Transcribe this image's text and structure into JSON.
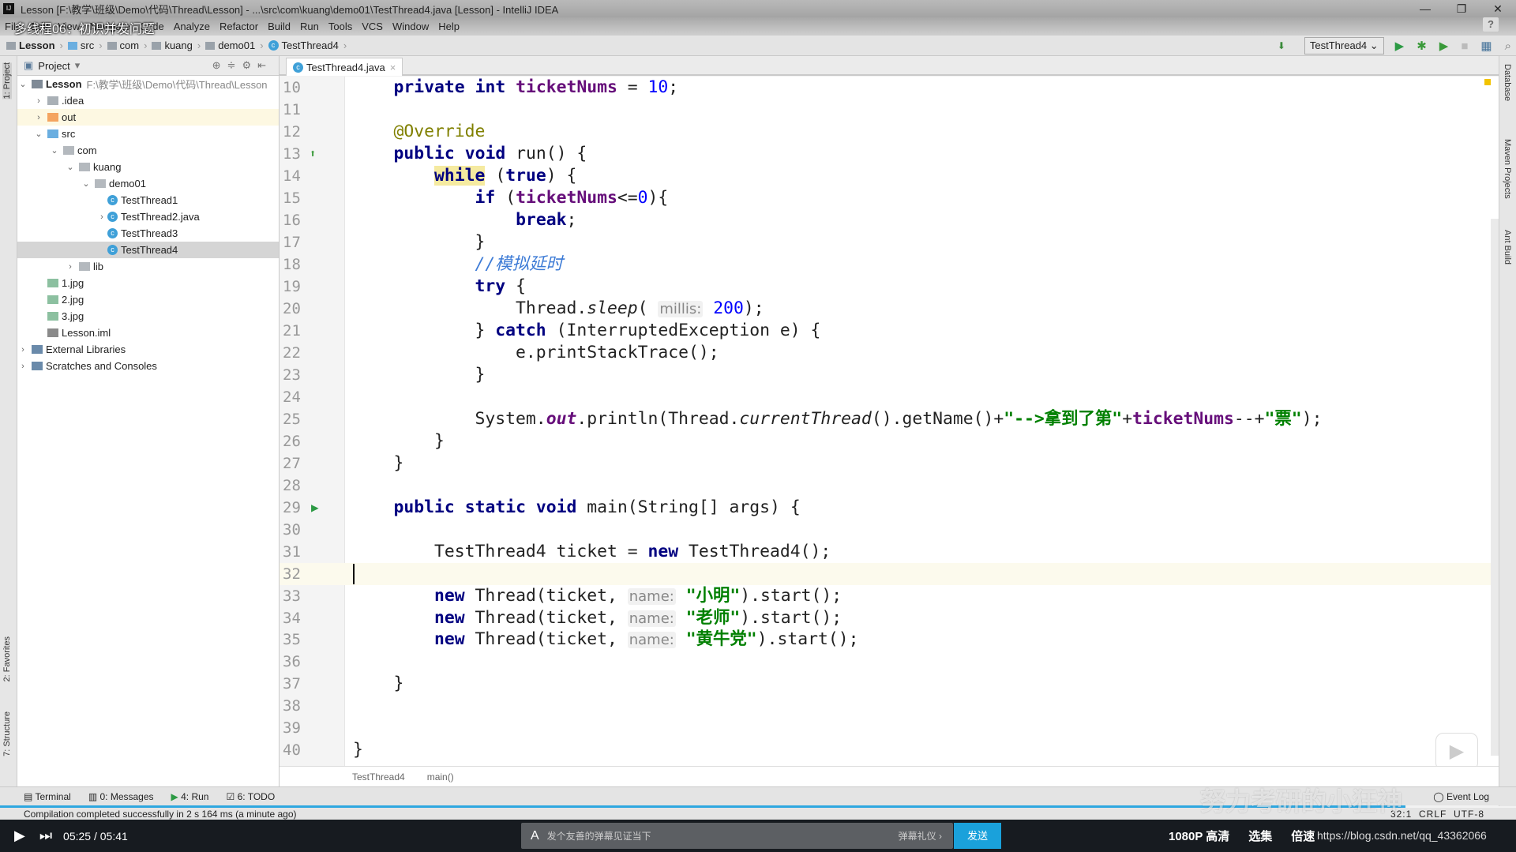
{
  "window": {
    "title": "Lesson [F:\\教学\\班级\\Demo\\代码\\Thread\\Lesson] - ...\\src\\com\\kuang\\demo01\\TestThread4.java [Lesson] - IntelliJ IDEA",
    "controls": [
      "—",
      "❐",
      "✕"
    ]
  },
  "video_overlay_title": "多线程06：初识并发问题",
  "menu": [
    "File",
    "Edit",
    "View",
    "Navigate",
    "Code",
    "Analyze",
    "Refactor",
    "Build",
    "Run",
    "Tools",
    "VCS",
    "Window",
    "Help"
  ],
  "breadcrumbs": [
    "Lesson",
    "src",
    "com",
    "kuang",
    "demo01",
    "TestThread4"
  ],
  "run_config": "TestThread4",
  "left_stripe": {
    "project": "1: Project",
    "favorites": "2: Favorites",
    "structure": "7: Structure"
  },
  "right_stripe": [
    "Database",
    "Maven Projects",
    "Ant Build"
  ],
  "project_panel": {
    "title": "Project",
    "tree": [
      {
        "label": "Lesson",
        "path": "F:\\教学\\班级\\Demo\\代码\\Thread\\Lesson",
        "depth": 0,
        "arrow": "open",
        "icon": "module",
        "bold": true
      },
      {
        "label": ".idea",
        "depth": 1,
        "arrow": "closed",
        "icon": "folder-gray"
      },
      {
        "label": "out",
        "depth": 1,
        "arrow": "closed",
        "icon": "folder-orange",
        "highlight": true
      },
      {
        "label": "src",
        "depth": 1,
        "arrow": "open",
        "icon": "folder-blue"
      },
      {
        "label": "com",
        "depth": 2,
        "arrow": "open",
        "icon": "package"
      },
      {
        "label": "kuang",
        "depth": 3,
        "arrow": "open",
        "icon": "package"
      },
      {
        "label": "demo01",
        "depth": 4,
        "arrow": "open",
        "icon": "package"
      },
      {
        "label": "TestThread1",
        "depth": 5,
        "arrow": "none",
        "icon": "class"
      },
      {
        "label": "TestThread2.java",
        "depth": 5,
        "arrow": "closed",
        "icon": "class"
      },
      {
        "label": "TestThread3",
        "depth": 5,
        "arrow": "none",
        "icon": "class"
      },
      {
        "label": "TestThread4",
        "depth": 5,
        "arrow": "none",
        "icon": "class",
        "selected": true
      },
      {
        "label": "lib",
        "depth": 3,
        "arrow": "closed",
        "icon": "package"
      },
      {
        "label": "1.jpg",
        "depth": 1,
        "arrow": "none",
        "icon": "image"
      },
      {
        "label": "2.jpg",
        "depth": 1,
        "arrow": "none",
        "icon": "image"
      },
      {
        "label": "3.jpg",
        "depth": 1,
        "arrow": "none",
        "icon": "image"
      },
      {
        "label": "Lesson.iml",
        "depth": 1,
        "arrow": "none",
        "icon": "iml"
      },
      {
        "label": "External Libraries",
        "depth": 0,
        "arrow": "closed",
        "icon": "libraries"
      },
      {
        "label": "Scratches and Consoles",
        "depth": 0,
        "arrow": "closed",
        "icon": "scratches"
      }
    ]
  },
  "editor": {
    "tab": "TestThread4.java",
    "current_line": 32,
    "lines": [
      {
        "n": "10",
        "t": [
          [
            "",
            "    "
          ],
          [
            "kw",
            "private"
          ],
          [
            "",
            " "
          ],
          [
            "kw",
            "int"
          ],
          [
            "",
            " "
          ],
          [
            "fld",
            "ticketNums"
          ],
          [
            "",
            " = "
          ],
          [
            "num",
            "10"
          ],
          [
            "",
            ";"
          ]
        ]
      },
      {
        "n": "11",
        "t": []
      },
      {
        "n": "12",
        "t": [
          [
            "",
            "    "
          ],
          [
            "ann",
            "@Override"
          ]
        ]
      },
      {
        "n": "13",
        "t": [
          [
            "",
            "    "
          ],
          [
            "kw",
            "public"
          ],
          [
            "",
            " "
          ],
          [
            "kw",
            "void"
          ],
          [
            "",
            " run() {"
          ]
        ]
      },
      {
        "n": "14",
        "t": [
          [
            "",
            "        "
          ],
          [
            "kw hlw",
            "while"
          ],
          [
            "",
            " ("
          ],
          [
            "kw",
            "true"
          ],
          [
            "",
            ") {"
          ]
        ]
      },
      {
        "n": "15",
        "t": [
          [
            "",
            "            "
          ],
          [
            "kw",
            "if"
          ],
          [
            "",
            " ("
          ],
          [
            "fld",
            "ticketNums"
          ],
          [
            "",
            "<="
          ],
          [
            "num",
            "0"
          ],
          [
            "",
            "){"
          ]
        ]
      },
      {
        "n": "16",
        "t": [
          [
            "",
            "                "
          ],
          [
            "kw",
            "break"
          ],
          [
            "",
            ";"
          ]
        ]
      },
      {
        "n": "17",
        "t": [
          [
            "",
            "            }"
          ]
        ]
      },
      {
        "n": "18",
        "t": [
          [
            "",
            "            "
          ],
          [
            "cmt",
            "//模拟延时"
          ]
        ]
      },
      {
        "n": "19",
        "t": [
          [
            "",
            "            "
          ],
          [
            "kw",
            "try"
          ],
          [
            "",
            " {"
          ]
        ]
      },
      {
        "n": "20",
        "t": [
          [
            "",
            "                Thread."
          ],
          [
            "ital",
            "sleep"
          ],
          [
            "",
            "( "
          ],
          [
            "hint",
            "millis:"
          ],
          [
            "",
            " "
          ],
          [
            "num",
            "200"
          ],
          [
            "",
            ");"
          ]
        ]
      },
      {
        "n": "21",
        "t": [
          [
            "",
            "            } "
          ],
          [
            "kw",
            "catch"
          ],
          [
            "",
            " (InterruptedException e) {"
          ]
        ]
      },
      {
        "n": "22",
        "t": [
          [
            "",
            "                e.printStackTrace();"
          ]
        ]
      },
      {
        "n": "23",
        "t": [
          [
            "",
            "            }"
          ]
        ]
      },
      {
        "n": "24",
        "t": []
      },
      {
        "n": "25",
        "t": [
          [
            "",
            "            System."
          ],
          [
            "sfld",
            "out"
          ],
          [
            "",
            ".println(Thread."
          ],
          [
            "ital",
            "currentThread"
          ],
          [
            "",
            "().getName()+"
          ],
          [
            "str",
            "\"-->拿到了第\""
          ],
          [
            "",
            "+"
          ],
          [
            "fld",
            "ticketNums"
          ],
          [
            "",
            "--+"
          ],
          [
            "str",
            "\"票\""
          ],
          [
            "",
            ");"
          ]
        ]
      },
      {
        "n": "26",
        "t": [
          [
            "",
            "        }"
          ]
        ]
      },
      {
        "n": "27",
        "t": [
          [
            "",
            "    }"
          ]
        ]
      },
      {
        "n": "28",
        "t": []
      },
      {
        "n": "29",
        "t": [
          [
            "",
            "    "
          ],
          [
            "kw",
            "public"
          ],
          [
            "",
            " "
          ],
          [
            "kw",
            "static"
          ],
          [
            "",
            " "
          ],
          [
            "kw",
            "void"
          ],
          [
            "",
            " main(String[] args) {"
          ]
        ]
      },
      {
        "n": "30",
        "t": []
      },
      {
        "n": "31",
        "t": [
          [
            "",
            "        TestThread4 ticket = "
          ],
          [
            "kw",
            "new"
          ],
          [
            "",
            " TestThread4();"
          ]
        ]
      },
      {
        "n": "32",
        "t": []
      },
      {
        "n": "33",
        "t": [
          [
            "",
            "        "
          ],
          [
            "kw",
            "new"
          ],
          [
            "",
            " Thread(ticket, "
          ],
          [
            "hint",
            "name:"
          ],
          [
            "",
            " "
          ],
          [
            "str",
            "\"小明\""
          ],
          [
            "",
            ").start();"
          ]
        ]
      },
      {
        "n": "34",
        "t": [
          [
            "",
            "        "
          ],
          [
            "kw",
            "new"
          ],
          [
            "",
            " Thread(ticket, "
          ],
          [
            "hint",
            "name:"
          ],
          [
            "",
            " "
          ],
          [
            "str",
            "\"老师\""
          ],
          [
            "",
            ").start();"
          ]
        ]
      },
      {
        "n": "35",
        "t": [
          [
            "",
            "        "
          ],
          [
            "kw",
            "new"
          ],
          [
            "",
            " Thread(ticket, "
          ],
          [
            "hint",
            "name:"
          ],
          [
            "",
            " "
          ],
          [
            "str",
            "\"黄牛党\""
          ],
          [
            "",
            ").start();"
          ]
        ]
      },
      {
        "n": "36",
        "t": []
      },
      {
        "n": "37",
        "t": [
          [
            "",
            "    }"
          ]
        ]
      },
      {
        "n": "38",
        "t": []
      },
      {
        "n": "39",
        "t": []
      },
      {
        "n": "40",
        "t": [
          [
            "",
            "}"
          ]
        ]
      }
    ],
    "breadcrumbs": [
      "TestThread4",
      "main()"
    ]
  },
  "tool_tabs": [
    "Terminal",
    "0: Messages",
    "4: Run",
    "6: TODO"
  ],
  "event_log": "Event Log",
  "status": {
    "message": "Compilation completed successfully in 2 s 164 ms (a minute ago)",
    "position": "32:1",
    "line_sep": "CRLF",
    "encoding": "UTF-8"
  },
  "watermark": "努力考研的小狂神",
  "player": {
    "time": "05:25 / 05:41",
    "danmu_placeholder": "发个友善的弹幕见证当下",
    "danmu_etiquette": "弹幕礼仪 ›",
    "send": "发送",
    "quality": "1080P 高清",
    "episodes": "选集",
    "speed": "倍速",
    "url": "https://blog.csdn.net/qq_43362066"
  },
  "colors": {
    "keyword": "#000080",
    "string": "#008000",
    "field": "#660e7a",
    "number": "#0000ff",
    "accent": "#2ea7e0",
    "send": "#1aa1db"
  }
}
